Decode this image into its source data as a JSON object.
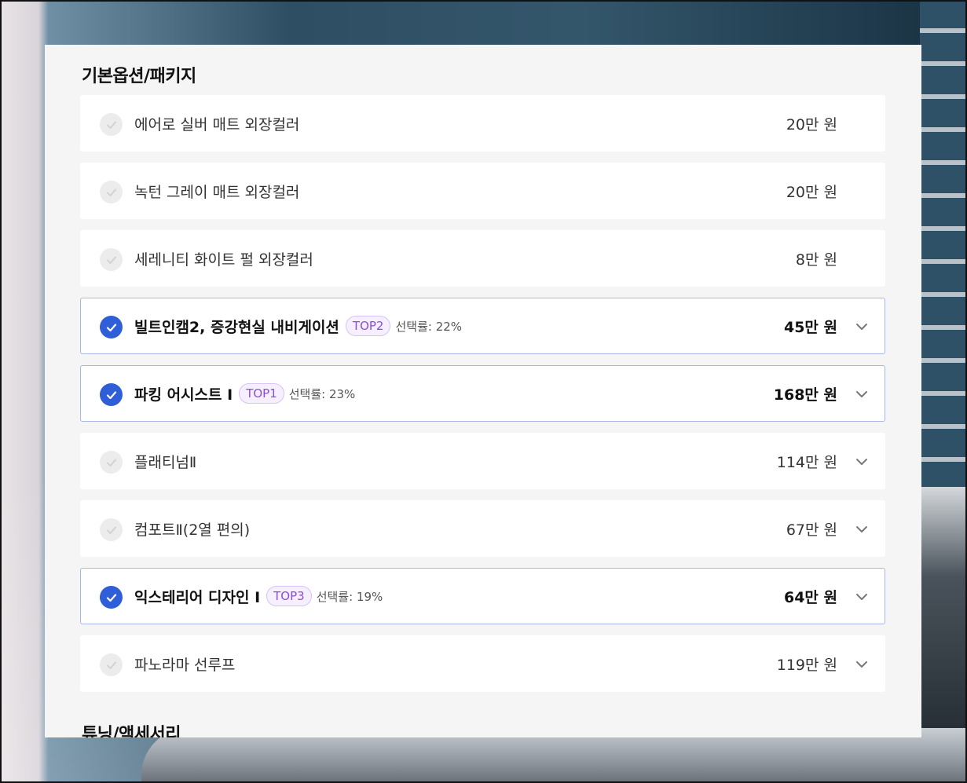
{
  "section_title": "기본옵션/패키지",
  "next_section_title": "튜닝/액세서리",
  "colors": {
    "accent": "#2f5fd8",
    "badge_text": "#8b4fd6",
    "selected_border": "#a7b7e6"
  },
  "options": [
    {
      "name": "에어로 실버 매트 외장컬러",
      "price": "20만 원",
      "selected": false,
      "expandable": false
    },
    {
      "name": "녹턴 그레이 매트 외장컬러",
      "price": "20만 원",
      "selected": false,
      "expandable": false
    },
    {
      "name": "세레니티 화이트 펄 외장컬러",
      "price": "8만 원",
      "selected": false,
      "expandable": false
    },
    {
      "name": "빌트인캠2, 증강현실 내비게이션",
      "badge": "TOP2",
      "rate": "선택률: 22%",
      "price": "45만 원",
      "selected": true,
      "expandable": true
    },
    {
      "name": "파킹 어시스트 Ⅰ",
      "badge": "TOP1",
      "rate": "선택률: 23%",
      "price": "168만 원",
      "selected": true,
      "expandable": true
    },
    {
      "name": "플래티넘Ⅱ",
      "price": "114만 원",
      "selected": false,
      "expandable": true
    },
    {
      "name": "컴포트Ⅱ(2열 편의)",
      "price": "67만 원",
      "selected": false,
      "expandable": true
    },
    {
      "name": "익스테리어 디자인 Ⅰ",
      "badge": "TOP3",
      "rate": "선택률: 19%",
      "price": "64만 원",
      "selected": true,
      "expandable": true
    },
    {
      "name": "파노라마 선루프",
      "price": "119만 원",
      "selected": false,
      "expandable": true
    }
  ]
}
